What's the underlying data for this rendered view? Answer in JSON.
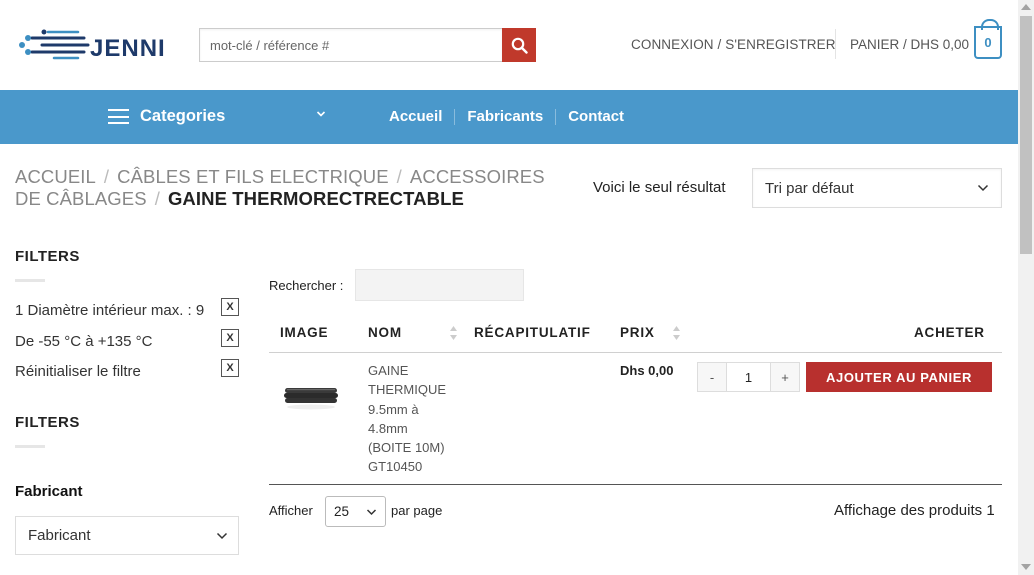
{
  "header": {
    "logo_text": "JENNI",
    "search_placeholder": "mot-clé / référence #",
    "account_label": "CONNEXION / S'ENREGISTRER",
    "cart_label": "PANIER / DHS 0,00",
    "cart_count": "0"
  },
  "colors": {
    "nav_bg": "#4a98cb",
    "accent_red": "#b8302e",
    "logo_blue": "#1e3a6a",
    "cart_blue": "#3d8fc2"
  },
  "nav": {
    "categories_label": "Categories",
    "links": [
      "Accueil",
      "Fabricants",
      "Contact"
    ]
  },
  "breadcrumb": {
    "items": [
      "ACCUEIL",
      "CÂBLES ET FILS ELECTRIQUE",
      "ACCESSOIRES DE CÂBLAGES"
    ],
    "current": "GAINE THERMORECTRECTABLE"
  },
  "results": {
    "count_text": "Voici le seul résultat",
    "sort_selected": "Tri par défaut"
  },
  "sidebar": {
    "active_title": "FILTERS",
    "active_filters": [
      "1 Diamètre intérieur max. : 9",
      "De -55 °C à +135 °C",
      "Réinitialiser le filtre"
    ],
    "filter_remove_glyph": "X",
    "filters_title": "FILTERS",
    "fabricant_label": "Fabricant",
    "fabricant_selected": "Fabricant"
  },
  "table": {
    "search_label": "Rechercher :",
    "columns": [
      "IMAGE",
      "NOM",
      "RÉCAPITULATIF",
      "PRIX",
      "ACHETER"
    ],
    "rows": [
      {
        "name_lines": [
          "GAINE",
          "THERMIQUE",
          "9.5mm à",
          "4.8mm",
          "(BOITE 10M)",
          "GT10450"
        ],
        "summary": "",
        "price": "Dhs 0,00",
        "qty_minus": "-",
        "qty": "1",
        "qty_plus": "+",
        "add_label": "AJOUTER AU PANIER"
      }
    ],
    "per_page_prefix": "Afficher",
    "per_page_value": "25",
    "per_page_suffix": "par page",
    "showing_text": "Affichage des produits 1"
  }
}
